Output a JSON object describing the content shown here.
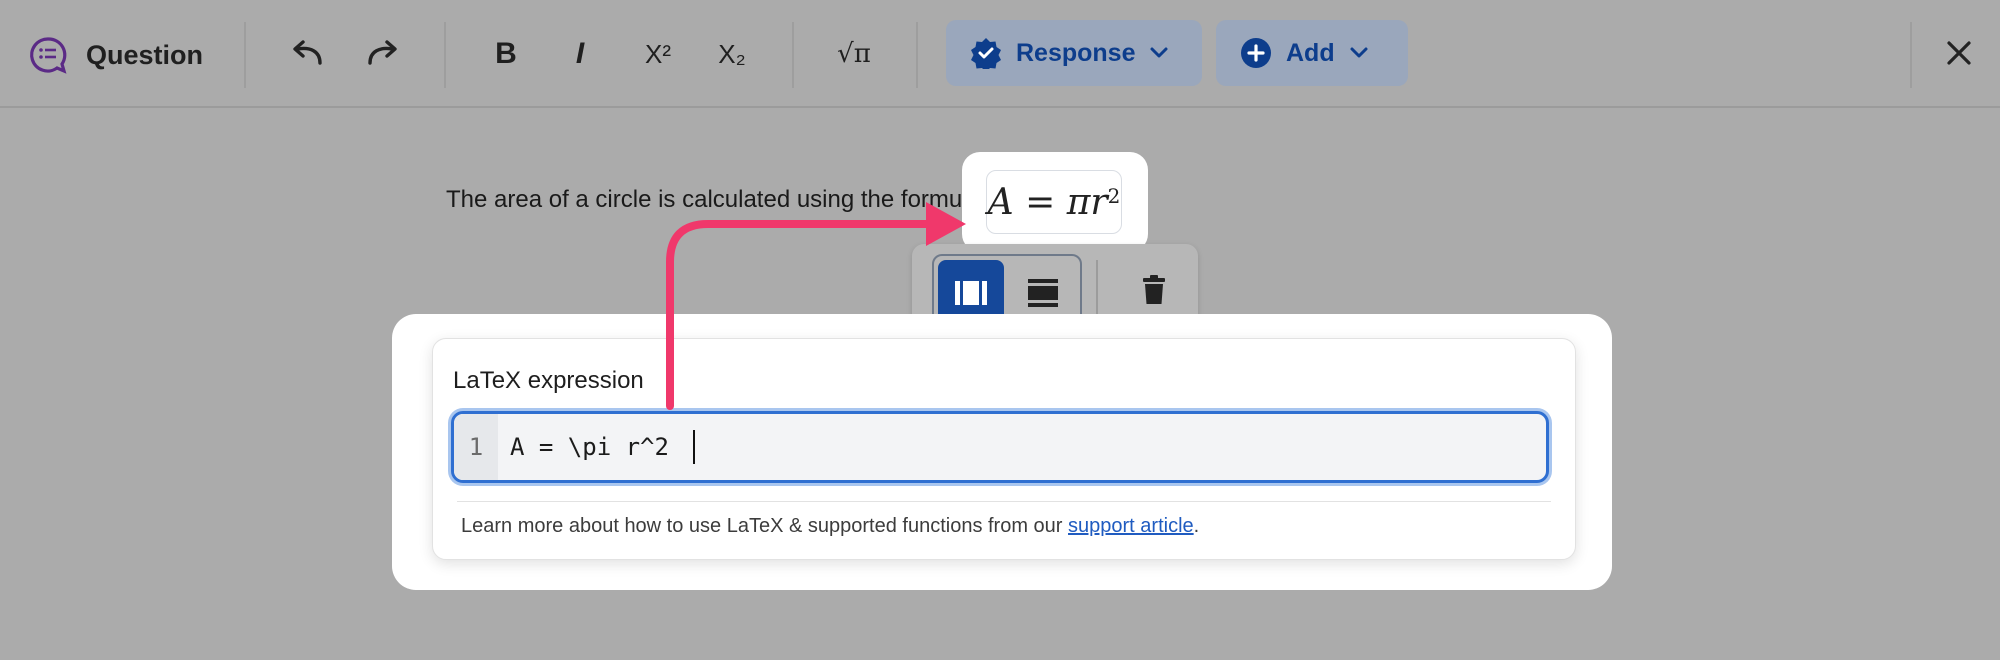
{
  "toolbar": {
    "title": "Question",
    "bold_label": "B",
    "italic_label": "I",
    "superscript_label": "X²",
    "subscript_label": "X₂",
    "math_label": "√π",
    "response_label": "Response",
    "add_label": "Add"
  },
  "content": {
    "sentence": "The area of a circle is calculated using the formula",
    "formula_base": "A = πr",
    "formula_exp": "2"
  },
  "latex_panel": {
    "label": "LaTeX expression",
    "line_number": "1",
    "code": "A = \\pi r^2 ",
    "help_prefix": "Learn more about how to use LaTeX & supported functions from our ",
    "help_link": "support article",
    "help_suffix": "."
  },
  "colors": {
    "accent": "#15489a",
    "annotation_arrow": "#f0386b",
    "overlay": "#ababab"
  }
}
